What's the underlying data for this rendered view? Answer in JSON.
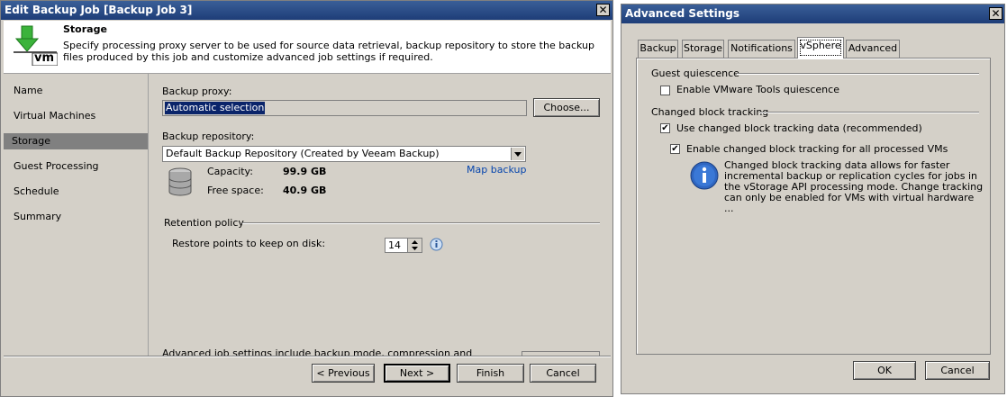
{
  "left_window": {
    "title": "Edit Backup Job [Backup Job 3]",
    "close_glyph": "✕",
    "header": {
      "title": "Storage",
      "description": "Specify processing proxy server to be used for source data retrieval, backup repository to store the backup files produced by this job and customize advanced job settings if required.",
      "icon_text": "vm"
    },
    "nav": [
      {
        "label": "Name"
      },
      {
        "label": "Virtual Machines"
      },
      {
        "label": "Storage"
      },
      {
        "label": "Guest Processing"
      },
      {
        "label": "Schedule"
      },
      {
        "label": "Summary"
      }
    ],
    "proxy": {
      "label": "Backup proxy:",
      "value": "Automatic selection",
      "choose_button": "Choose..."
    },
    "repository": {
      "label": "Backup repository:",
      "value": "Default Backup Repository (Created by Veeam Backup)",
      "capacity_label": "Capacity:",
      "capacity_value": "99.9 GB",
      "free_label": "Free space:",
      "free_value": "40.9 GB",
      "map_link": "Map backup"
    },
    "retention": {
      "group_label": "Retention policy",
      "restore_label": "Restore points to keep on disk:",
      "restore_value": "14"
    },
    "advanced_text": "Advanced job settings include backup mode, compression and",
    "buttons": {
      "previous": "< Previous",
      "next": "Next >",
      "finish": "Finish",
      "cancel": "Cancel"
    }
  },
  "right_window": {
    "title": "Advanced Settings",
    "close_glyph": "✕",
    "tabs": [
      {
        "label": "Backup"
      },
      {
        "label": "Storage"
      },
      {
        "label": "Notifications"
      },
      {
        "label": "vSphere"
      },
      {
        "label": "Advanced"
      }
    ],
    "active_tab": "vSphere",
    "guest_group": "Guest quiescence",
    "enable_tools": "Enable VMware Tools quiescence",
    "enable_tools_checked": false,
    "cbt_group": "Changed block tracking",
    "use_cbt": "Use changed block tracking data (recommended)",
    "use_cbt_checked": true,
    "enable_cbt": "Enable changed block tracking for all processed VMs",
    "enable_cbt_checked": true,
    "info_lines": [
      "Changed block tracking data allows for faster",
      "incremental backup or replication cycles for jobs in",
      "the vStorage API processing mode. Change tracking",
      "can only be enabled for VMs with virtual hardware ..."
    ],
    "ok": "OK",
    "cancel": "Cancel",
    "check_glyph": "✔"
  }
}
